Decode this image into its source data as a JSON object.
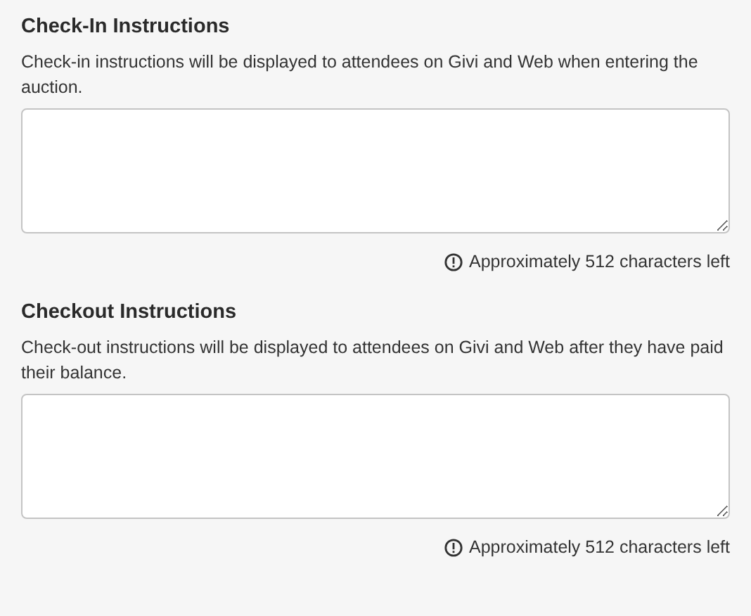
{
  "sections": [
    {
      "title": "Check-In Instructions",
      "description": "Check-in instructions will be displayed to attendees on Givi and Web when entering the auction.",
      "counter": "Approximately 512 characters left"
    },
    {
      "title": "Checkout Instructions",
      "description": "Check-out instructions will be displayed to attendees on Givi and Web after they have paid their balance.",
      "counter": "Approximately 512 characters left"
    }
  ]
}
